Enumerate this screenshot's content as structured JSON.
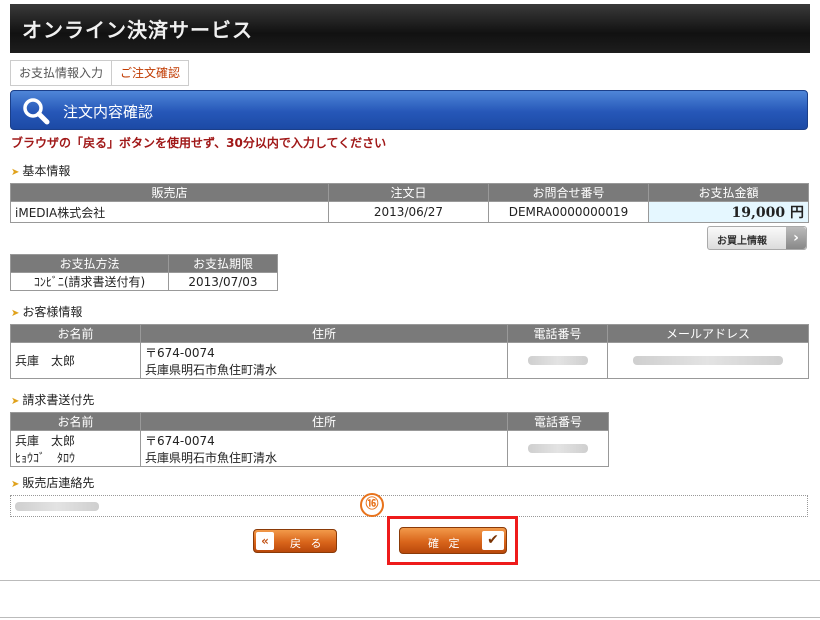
{
  "header": {
    "title": "オンライン決済サービス"
  },
  "breadcrumb": {
    "step1": "お支払情報入力",
    "step2": "ご注文確認"
  },
  "section": {
    "title": "注文内容確認"
  },
  "warning": "ブラウザの「戻る」ボタンを使用せず、30分以内で入力してください",
  "basic": {
    "heading": "基本情報",
    "headers": [
      "販売店",
      "注文日",
      "お問合せ番号",
      "お支払金額"
    ],
    "store": "iMEDIA株式会社",
    "order_date": "2013/06/27",
    "inquiry_no": "DEMRA0000000019",
    "amount": "19,000 円",
    "buy_info_button": "お買上情報"
  },
  "payment": {
    "headers": [
      "お支払方法",
      "お支払期限"
    ],
    "method": "ｺﾝﾋﾞﾆ(請求書送付有)",
    "deadline": "2013/07/03"
  },
  "customer": {
    "heading": "お客様情報",
    "headers": [
      "お名前",
      "住所",
      "電話番号",
      "メールアドレス"
    ],
    "name": "兵庫　太郎",
    "postal": "〒674-0074",
    "address": "兵庫県明石市魚住町清水"
  },
  "billing": {
    "heading": "請求書送付先",
    "headers": [
      "お名前",
      "住所",
      "電話番号"
    ],
    "name": "兵庫　太郎",
    "name_kana": "ﾋｮｳｺﾞ　ﾀﾛｳ",
    "postal": "〒674-0074",
    "address": "兵庫県明石市魚住町清水"
  },
  "store_contact": {
    "heading": "販売店連絡先"
  },
  "buttons": {
    "back": "戻 る",
    "back_icon": "«",
    "confirm": "確 定",
    "confirm_icon": "✔"
  },
  "annotation": {
    "step": "⑯"
  },
  "colors": {
    "highlight": "#ee1b1b",
    "warning": "#a01818",
    "section": "#2657b8",
    "button": "#d9651b"
  }
}
